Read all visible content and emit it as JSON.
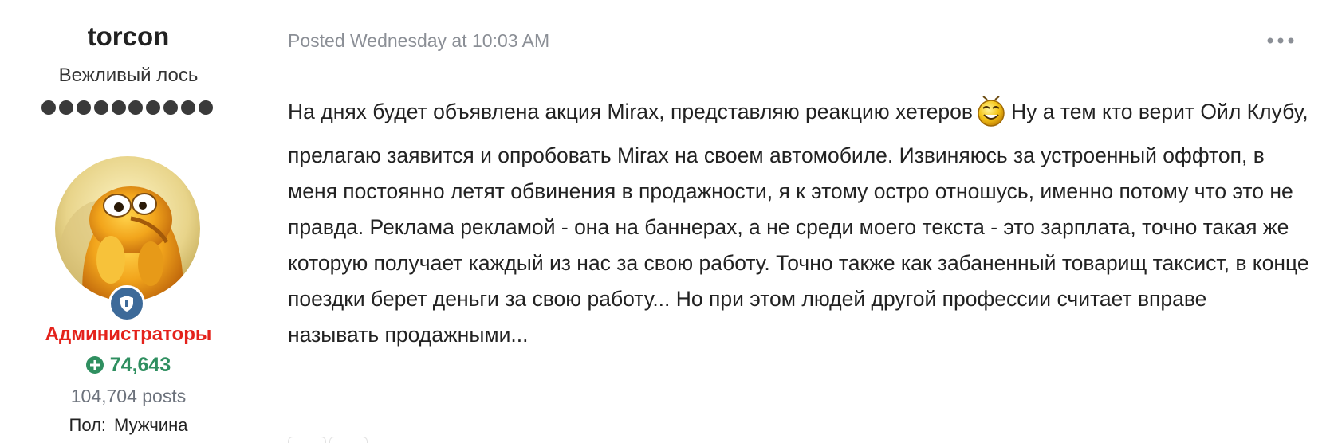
{
  "author": {
    "username": "torcon",
    "title": "Вежливый лось",
    "rank_pips": 10,
    "group": "Администраторы",
    "reputation": "74,643",
    "posts": "104,704 posts",
    "field_label": "Пол:",
    "field_value": "Мужчина"
  },
  "post": {
    "date": "Posted Wednesday at 10:03 AM",
    "body_part1": "На днях будет объявлена акция Mirax, представляю реакцию хетеров",
    "body_part2": "Ну а тем кто верит Ойл Клубу, прелагаю заявится и опробовать Mirax на своем автомобиле. Извиняюсь за устроенный оффтоп, в меня постоянно летят обвинения в продажности, я к этому остро отношусь, именно потому что это не правда. Реклама рекламой - она на баннерах, а не среди моего текста - это зарплата, точно такая же которую получает каждый из нас за свою работу. Точно также как забаненный товарищ таксист, в конце поездки берет деньги за свою работу... Но при этом людей другой профессии считает вправе",
    "body_part3": "называть продажными..."
  },
  "icons": {
    "group_badge": "shield-icon",
    "reputation": "plus-circle-icon",
    "menu": "more-dots-icon",
    "emoticon": "smiley-emoticon"
  },
  "colors": {
    "group": "#e4221b",
    "reputation": "#2f8f60",
    "badge": "#3d6a99",
    "meta": "#8b8f96"
  }
}
